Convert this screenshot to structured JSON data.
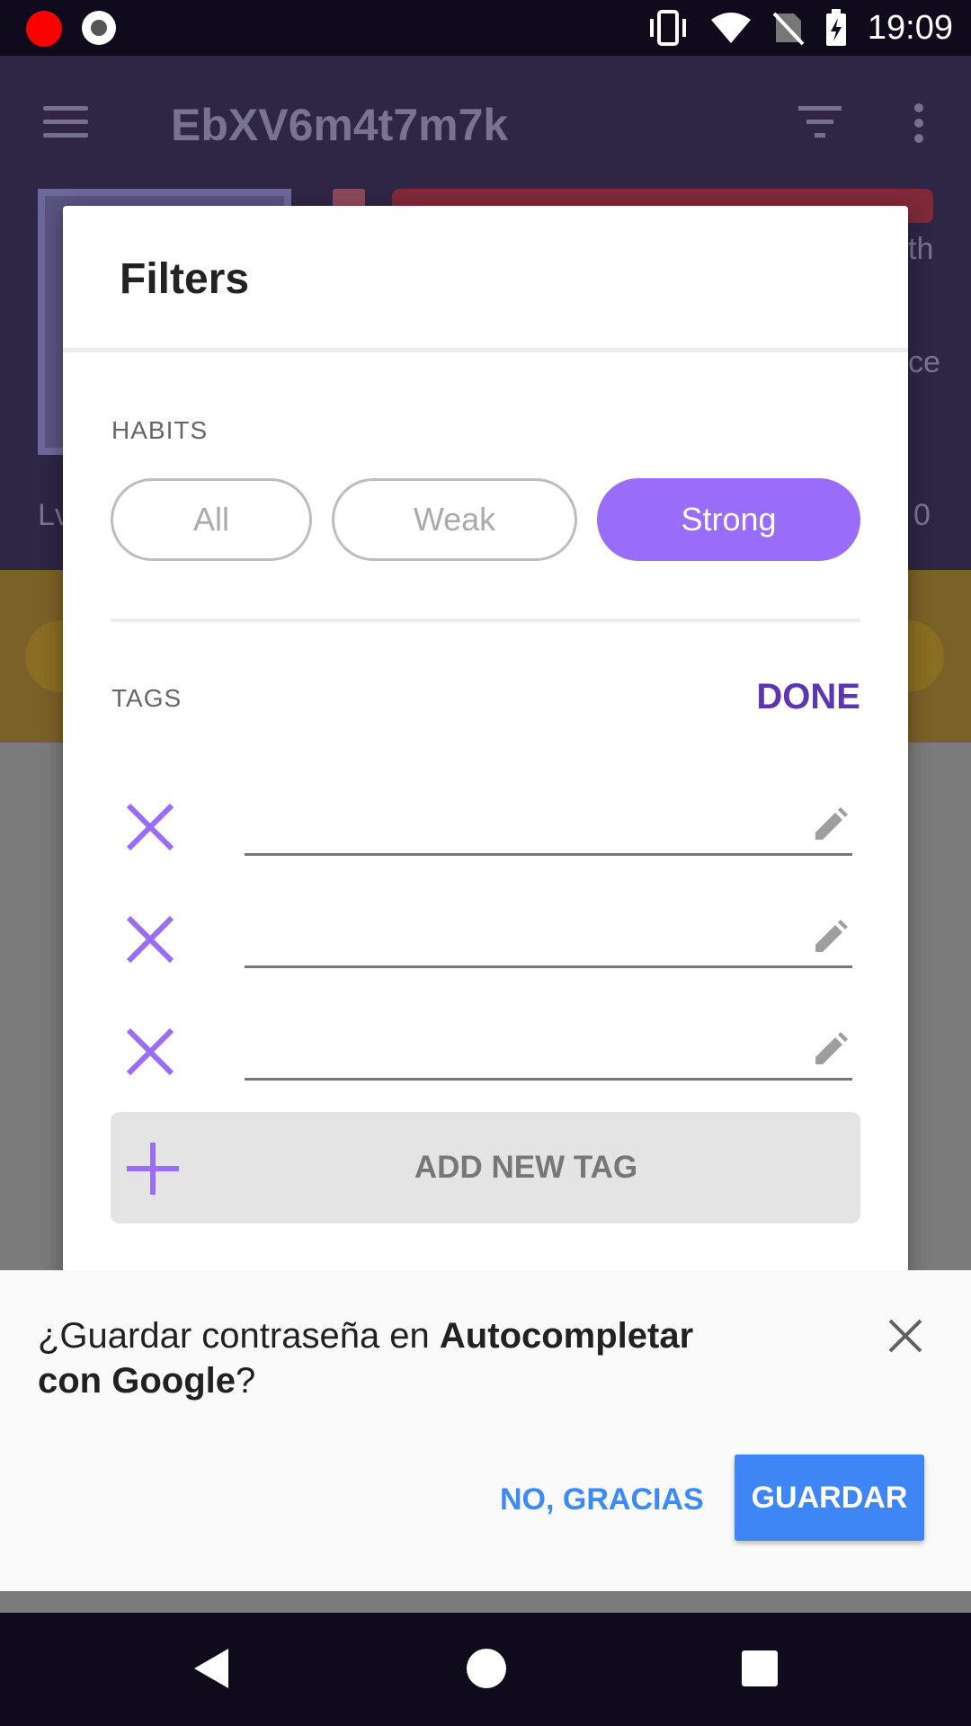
{
  "status_bar": {
    "time": "19:09"
  },
  "app_bar": {
    "title": "EbXV6m4t7m7k"
  },
  "background": {
    "lv_text": "Lv",
    "zero_text": "0",
    "th_text": "th",
    "ce_text": "ce"
  },
  "dialog": {
    "title": "Filters",
    "habits_label": "HABITS",
    "habit_filters": [
      {
        "label": "All",
        "selected": false
      },
      {
        "label": "Weak",
        "selected": false
      },
      {
        "label": "Strong",
        "selected": true
      }
    ],
    "tags_label": "TAGS",
    "done_label": "DONE",
    "tags": [
      {
        "value": ""
      },
      {
        "value": ""
      },
      {
        "value": ""
      }
    ],
    "add_tag_label": "ADD NEW TAG"
  },
  "autofill": {
    "prompt_prefix": "¿Guardar contraseña en ",
    "prompt_bold_1": "Autocompletar",
    "prompt_bold_2": "con Google",
    "prompt_suffix": "?",
    "no_thanks_label": "NO, GRACIAS",
    "save_label": "GUARDAR"
  },
  "colors": {
    "accent": "#9a6cfa",
    "done": "#5e35b1",
    "autofill_blue": "#3e86f5"
  }
}
